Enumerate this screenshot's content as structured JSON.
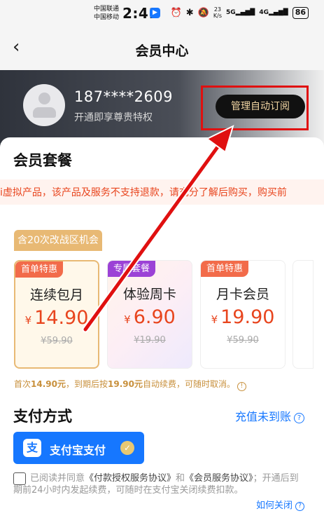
{
  "status_bar": {
    "carrier1": "中国联通",
    "carrier2": "中国移动",
    "time": "2:41",
    "net_speed_value": "23",
    "net_speed_unit": "K/s",
    "signal1": "5G",
    "signal2": "4G",
    "battery": "86"
  },
  "nav": {
    "title": "会员中心",
    "back_symbol": "‹"
  },
  "user": {
    "phone": "187****2609",
    "subtitle": "开通即享尊贵特权",
    "manage_button": "管理自动订阅"
  },
  "packages": {
    "title": "会员套餐",
    "notice": "i虚拟产品，该产品及服务不支持退款，请充分了解后购买，购买前",
    "promo_tag": "含20次改战区机会",
    "currency": "¥",
    "items": [
      {
        "badge": "首单特惠",
        "name": "连续包月",
        "price": "14.90",
        "original": "¥59.90"
      },
      {
        "badge": "专属套餐",
        "name": "体验周卡",
        "price": "6.90",
        "original": "¥19.90"
      },
      {
        "badge": "首单特惠",
        "name": "月卡会员",
        "price": "19.90",
        "original": "¥59.90"
      }
    ],
    "renew_note_pre": "首次",
    "renew_note_first": "14.90元",
    "renew_note_mid": "，到期后按",
    "renew_note_renew": "19.90元",
    "renew_note_post": "自动续费，可随时取消。",
    "info_symbol": "!"
  },
  "payment": {
    "title": "支付方式",
    "recharge_link": "充值未到账",
    "method_logo": "支",
    "method_label": "支付宝支付",
    "check_symbol": "✓",
    "help_symbol": "?"
  },
  "agreement": {
    "pre": "已阅读并同意",
    "link1": "《付款授权服务协议》",
    "and": "和",
    "link2": "《会员服务协议》",
    "post": "；开通后到期前24小时内发起续费，可随时在支付宝关闭续费扣款。",
    "how_close": "如何关闭"
  },
  "colors": {
    "accent_red": "#e8451e",
    "link_blue": "#1677ff",
    "gold": "#e8b974",
    "highlight_red": "#e01010"
  }
}
